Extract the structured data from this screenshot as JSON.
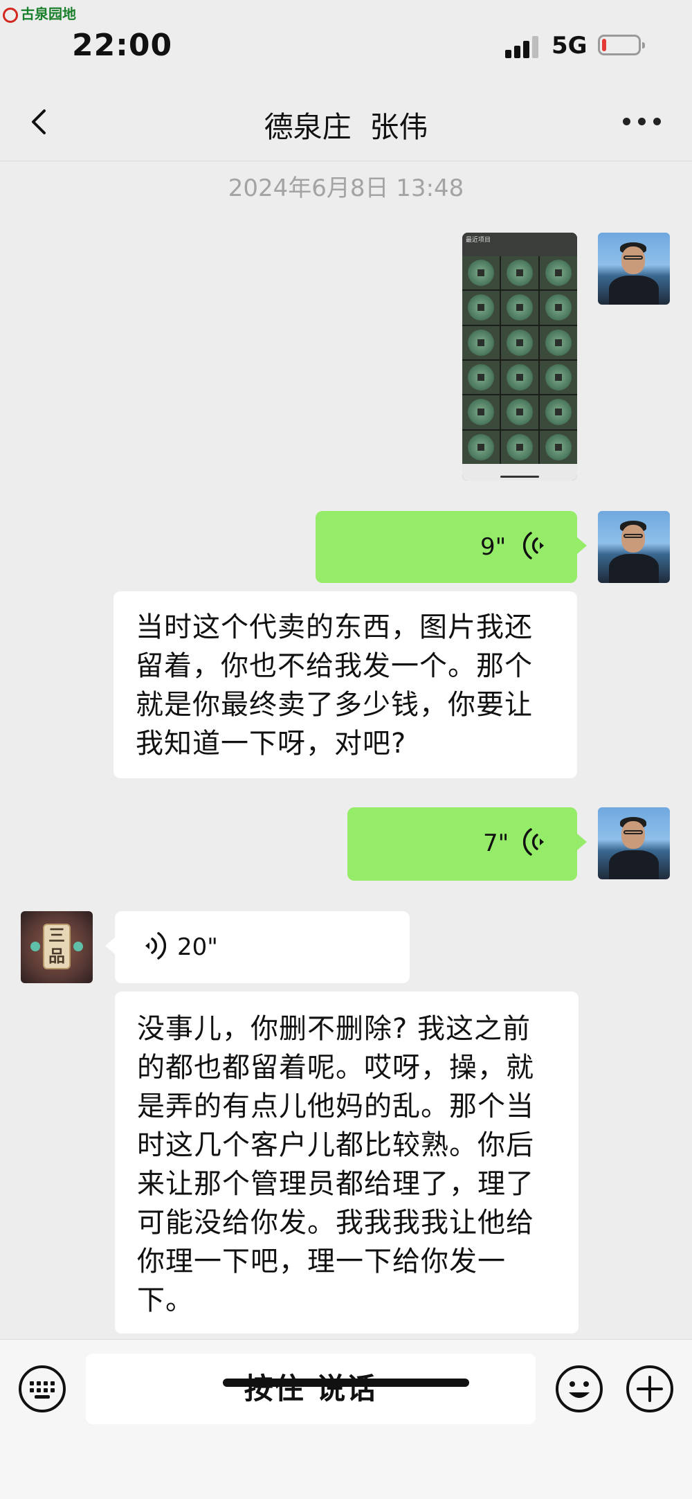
{
  "watermark": "古泉园地",
  "status_bar": {
    "time": "22:00",
    "network": "5G"
  },
  "nav": {
    "title": "德泉庄  张伟"
  },
  "timestamp": "2024年6月8日 13:48",
  "messages": [
    {
      "type": "image",
      "sender": "me",
      "image_topbar": "最近项目"
    },
    {
      "type": "voice",
      "sender": "me",
      "duration": "9\""
    },
    {
      "type": "text",
      "sender": "other",
      "lines": [
        "当时这个代卖的东西，图片我还",
        "留着，你也不给我发一个。那个",
        "就是你最终卖了多少钱，你要让",
        "我知道一下呀，对吧?"
      ]
    },
    {
      "type": "voice",
      "sender": "me",
      "duration": "7\""
    },
    {
      "type": "voice",
      "sender": "other",
      "duration": "20\""
    },
    {
      "type": "text",
      "sender": "other",
      "lines": [
        "没事儿，你删不删除? 我这之前",
        "的都也都留着呢。哎呀，操，就",
        "是弄的有点儿他妈的乱。那个当",
        "时这几个客户儿都比较熟。你后",
        "来让那个管理员都给理了，理了",
        "可能没给你发。我我我我让他给",
        "你理一下吧，理一下给你发一",
        "下。"
      ]
    }
  ],
  "other_avatar_tile": "三品",
  "input_bar": {
    "hold_to_talk": "按住 说话"
  },
  "colors": {
    "my_bubble": "#95ec69",
    "other_bubble": "#ffffff",
    "background": "#ededed",
    "battery_low": "#e53935"
  }
}
